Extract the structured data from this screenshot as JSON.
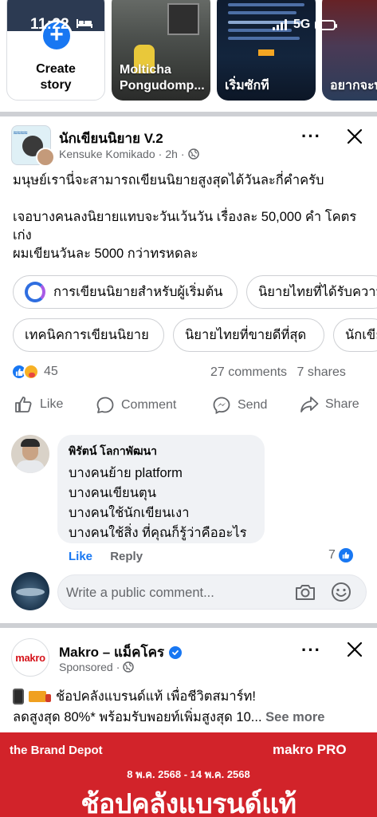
{
  "status_bar": {
    "time": "11:22",
    "network": "5G"
  },
  "stories": {
    "create_label_1": "Create",
    "create_label_2": "story",
    "items": [
      {
        "name_1": "Molticha",
        "name_2": "Pongudomp..."
      },
      {
        "name_1": "เริ่มซักที",
        "name_2": ""
      },
      {
        "name_1": "อยากจะพูด",
        "name_2": ""
      }
    ]
  },
  "post": {
    "group_name": "นักเขียนนิยาย V.2",
    "author": "Kensuke Komikado",
    "time": "2h",
    "more_label": "···",
    "body": [
      "มนุษย์เรานี่จะสามารถเขียนนิยายสูงสุดได้วันละกี่คำครับ",
      "",
      "เจอบางคนลงนิยายแทบจะวันเว้นวัน เรื่องละ 50,000 คำ โคตรเก่ง",
      "ผมเขียนวันละ 5000 กว่าทรหดละ"
    ],
    "chips_row1": [
      "การเขียนนิยายสำหรับผู้เริ่มต้น",
      "นิยายไทยที่ได้รับความ"
    ],
    "chips_row2": [
      "เทคนิคการเขียนนิยาย",
      "นิยายไทยที่ขายดีที่สุด",
      "นักเขียน"
    ],
    "reaction_count": "45",
    "comments_count": "27 comments",
    "shares_count": "7 shares",
    "actions": {
      "like": "Like",
      "comment": "Comment",
      "send": "Send",
      "share": "Share"
    }
  },
  "comment": {
    "author": "พิรัตน์ โลกาพัฒนา",
    "lines": [
      "บางคนย้าย platform",
      "บางคนเขียนตุน",
      "บางคนใช้นักเขียนเงา",
      "บางคนใช้สิ่ง ที่คุณก็รู้ว่าคืออะไร"
    ],
    "like_label": "Like",
    "reply_label": "Reply",
    "like_count": "7"
  },
  "write_comment": {
    "placeholder": "Write a public comment..."
  },
  "ad": {
    "logo_text": "makro",
    "page_name": "Makro – แม็คโคร",
    "sponsored": "Sponsored",
    "more_label": "···",
    "line1": "ช้อปคลังแบรนด์แท้ เพื่อชีวิตสมาร์ท!",
    "line2": "ลดสูงสุด 80%* พร้อมรับพอยท์เพิ่มสูงสุด 10...",
    "see_more": "See more",
    "banner": {
      "brand": "the Brand Depot",
      "makro_pro": "makro PRO",
      "dates": "8 พ.ค. 2568 - 14 พ.ค. 2568",
      "headline": "ช้อปคลังแบรนด์แท้"
    }
  },
  "colors": {
    "accent": "#1877f2",
    "secondary_text": "#65676b",
    "divider": "#ced0d4",
    "ad_red": "#d2232a"
  }
}
